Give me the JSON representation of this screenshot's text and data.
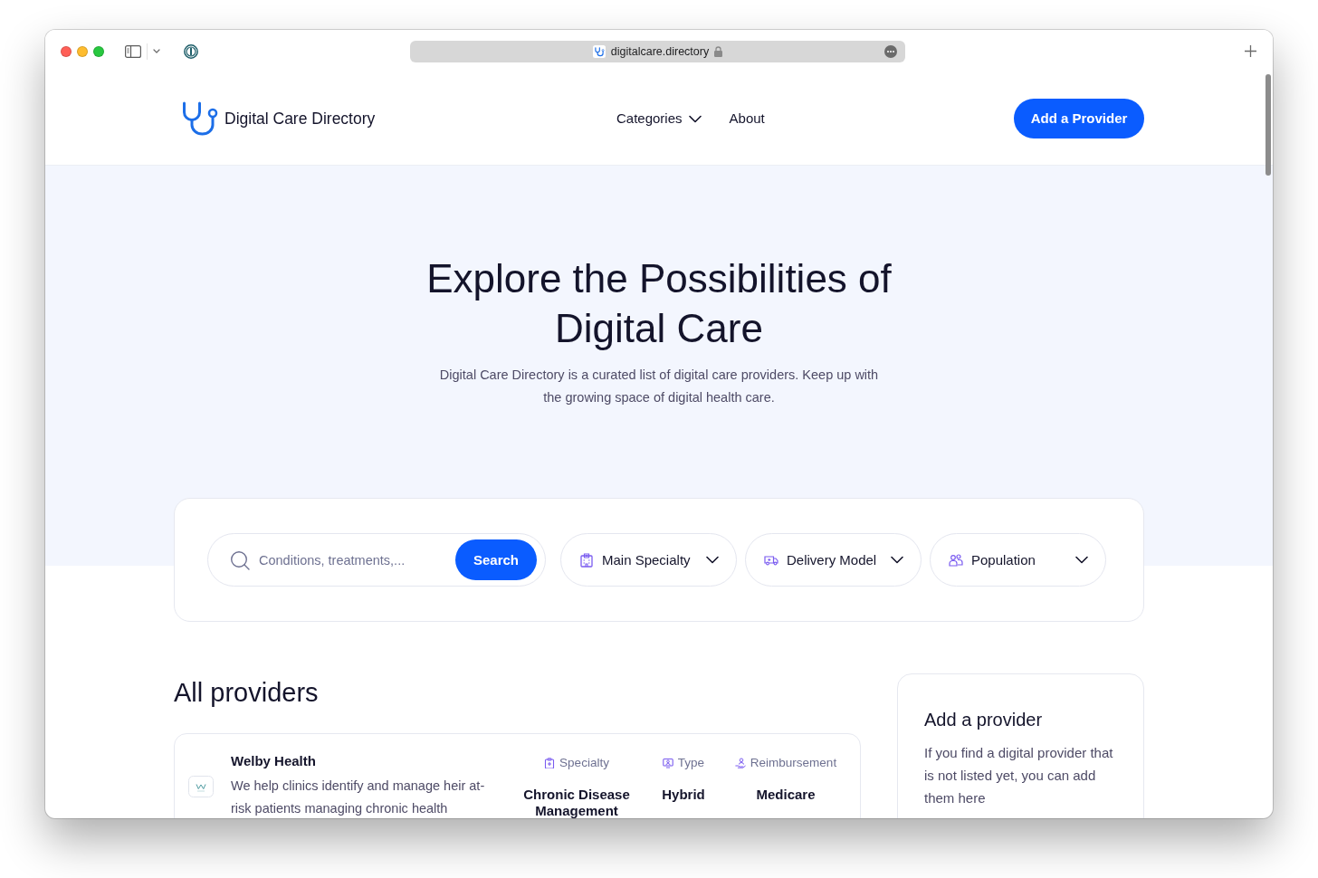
{
  "browser": {
    "url": "digitalcare.directory"
  },
  "header": {
    "brand": "Digital Care Directory",
    "nav": [
      {
        "label": "Categories",
        "kind": "dropdown"
      },
      {
        "label": "About",
        "kind": "link"
      }
    ],
    "cta": "Add a Provider"
  },
  "hero": {
    "title": "Explore the Possibilities of Digital Care",
    "subtitle": "Digital Care Directory is a curated list of digital care providers. Keep up with the growing space of digital health care."
  },
  "search": {
    "placeholder": "Conditions, treatments,...",
    "button": "Search",
    "filters": [
      {
        "label": "Main Specialty"
      },
      {
        "label": "Delivery Model"
      },
      {
        "label": "Population"
      }
    ]
  },
  "providers": {
    "heading": "All providers",
    "items": [
      {
        "name": "Welby Health",
        "description": "We help clinics identify and manage heir at-risk patients managing chronic health",
        "attributes": [
          {
            "label": "Specialty",
            "value": "Chronic Disease Management"
          },
          {
            "label": "Type",
            "value": "Hybrid"
          },
          {
            "label": "Reimbursement",
            "value": "Medicare"
          }
        ]
      }
    ]
  },
  "add_card": {
    "title": "Add a provider",
    "text": "If you find a digital provider that is not listed yet, you can add them here"
  }
}
